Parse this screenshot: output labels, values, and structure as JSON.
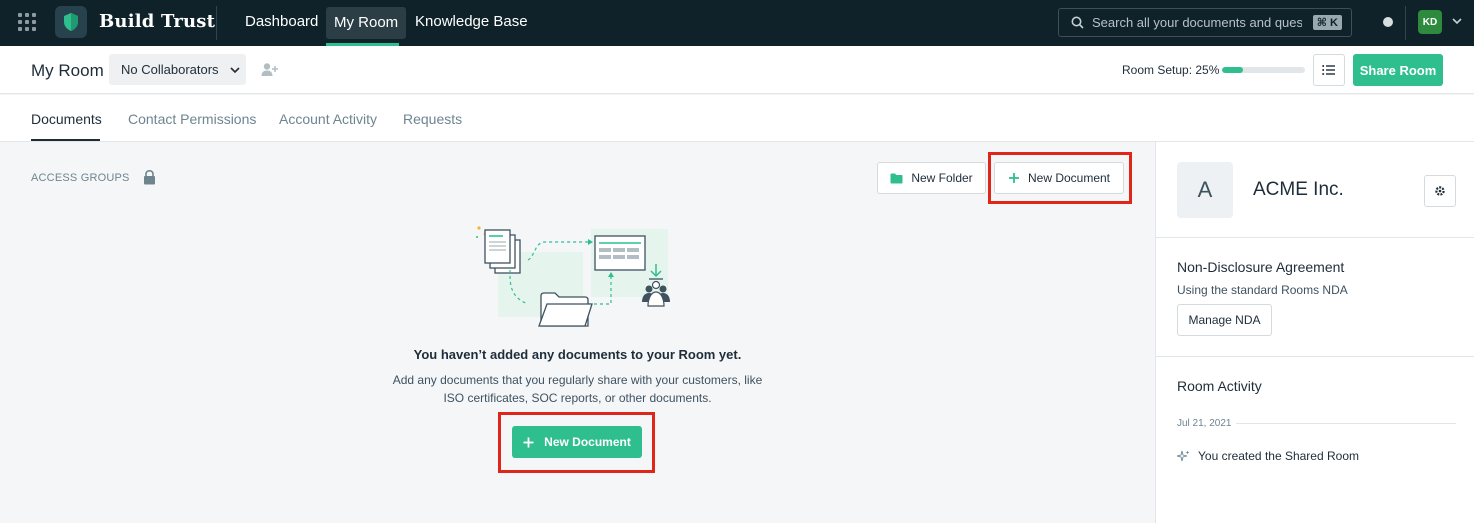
{
  "colors": {
    "accent": "#2fbf8f",
    "nav_bg": "#0f2129",
    "highlight": "#e0261b",
    "avatar_bg": "#2e8b3e"
  },
  "topnav": {
    "brand": "Build Trust",
    "links": [
      {
        "label": "Dashboard",
        "active": false
      },
      {
        "label": "My Room",
        "active": true
      },
      {
        "label": "Knowledge Base",
        "active": false
      }
    ],
    "search": {
      "placeholder": "Search all your documents and questions",
      "shortcut": "⌘ K"
    },
    "user_initials": "KD"
  },
  "room": {
    "title": "My Room",
    "collaborators_label": "No Collaborators",
    "setup_label": "Room Setup: 25%",
    "setup_progress": 0.25,
    "share_label": "Share Room"
  },
  "tabs": [
    {
      "label": "Documents",
      "active": true
    },
    {
      "label": "Contact Permissions",
      "active": false
    },
    {
      "label": "Account Activity",
      "active": false
    },
    {
      "label": "Requests",
      "active": false
    }
  ],
  "main": {
    "access_groups_label": "ACCESS GROUPS",
    "new_folder_label": "New Folder",
    "new_document_label": "New Document",
    "empty_title": "You haven’t added any documents to your Room yet.",
    "empty_desc": "Add any documents that you regularly share with your customers, like ISO certificates, SOC reports, or other documents.",
    "empty_cta_label": "New Document"
  },
  "panel": {
    "org_initial": "A",
    "org_name": "ACME Inc.",
    "nda_title": "Non-Disclosure Agreement",
    "nda_desc": "Using the standard Rooms NDA",
    "nda_button": "Manage NDA",
    "activity_title": "Room Activity",
    "activity_date": "Jul 21, 2021",
    "activity_item": "You created the Shared Room"
  }
}
